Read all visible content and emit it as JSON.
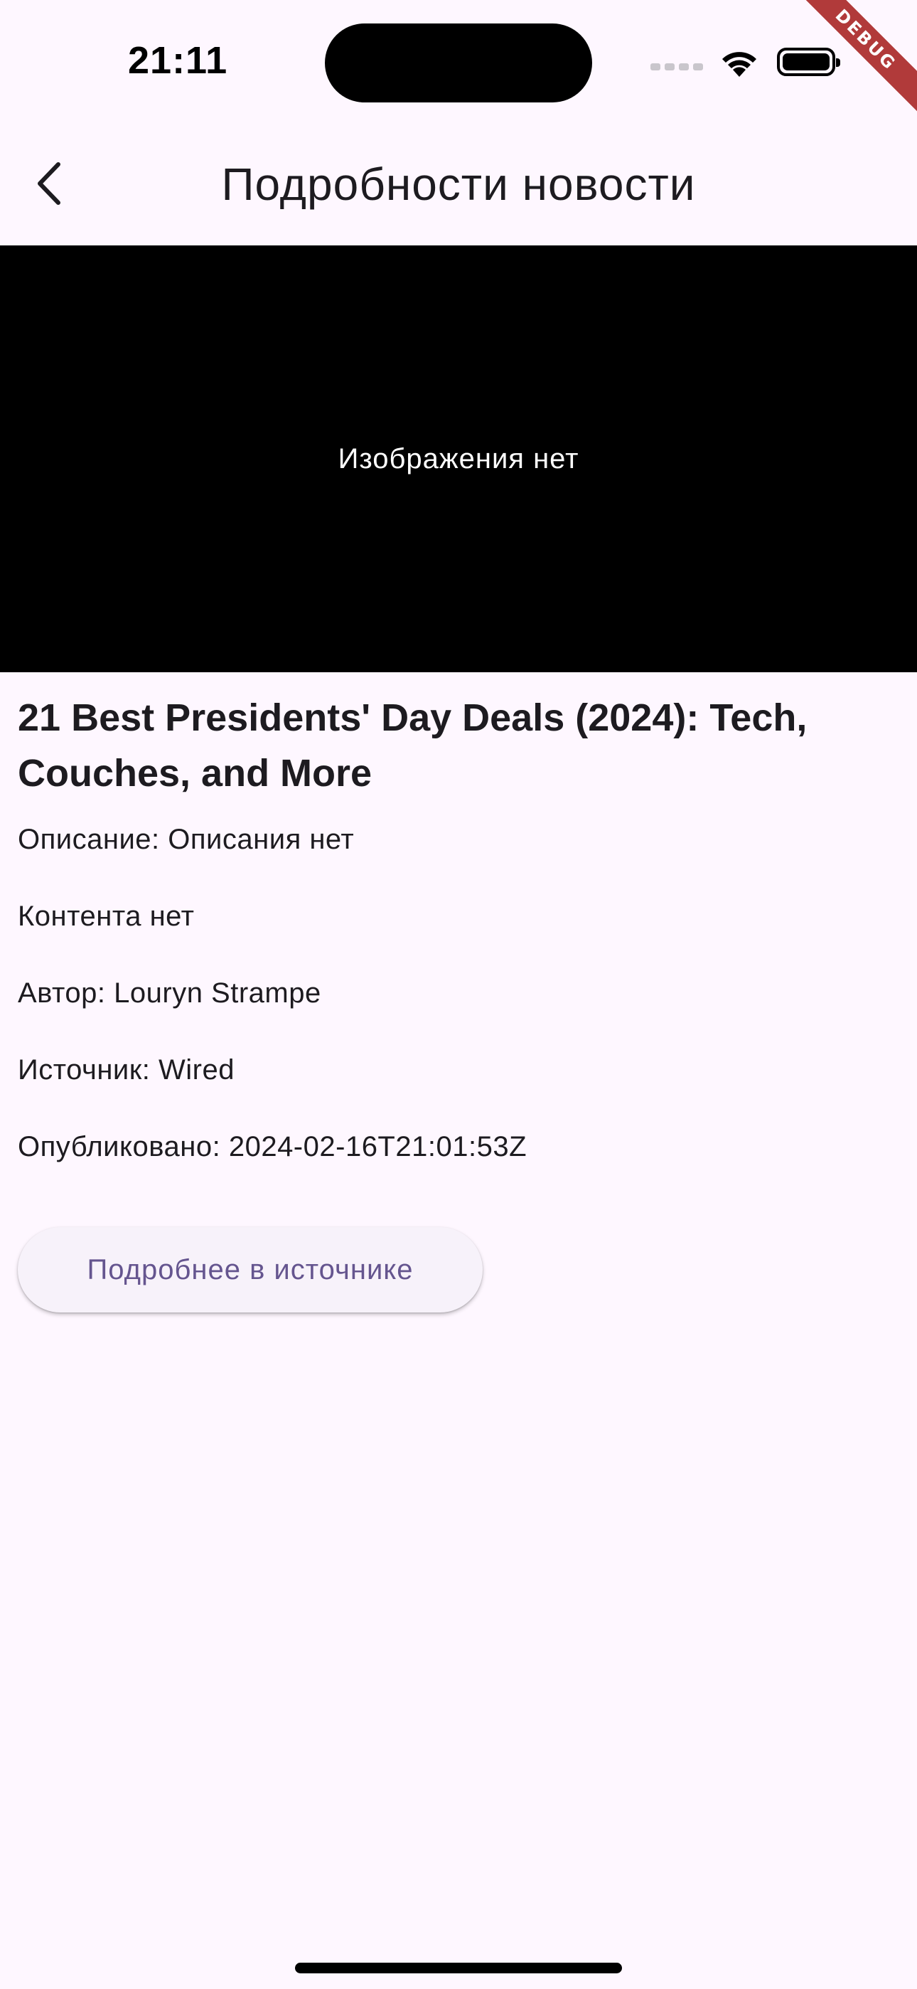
{
  "status_bar": {
    "time": "21:11"
  },
  "debug_banner": {
    "label": "DEBUG"
  },
  "app_bar": {
    "title": "Подробности новости",
    "back_icon": "chevron-left-icon"
  },
  "image": {
    "placeholder_text": "Изображения нет"
  },
  "article": {
    "title": "21 Best Presidents' Day Deals (2024): Tech, Couches, and More",
    "description": "Описание: Описания нет",
    "content": "Контента нет",
    "author": "Автор: Louryn Strampe",
    "source": "Источник: Wired",
    "published": "Опубликовано: 2024-02-16T21:01:53Z"
  },
  "actions": {
    "open_source_label": "Подробнее в источнике"
  },
  "colors": {
    "background": "#fef7ff",
    "button_text": "#65558f",
    "button_background": "#f7f2fa",
    "debug_ribbon": "#b13a3a"
  }
}
